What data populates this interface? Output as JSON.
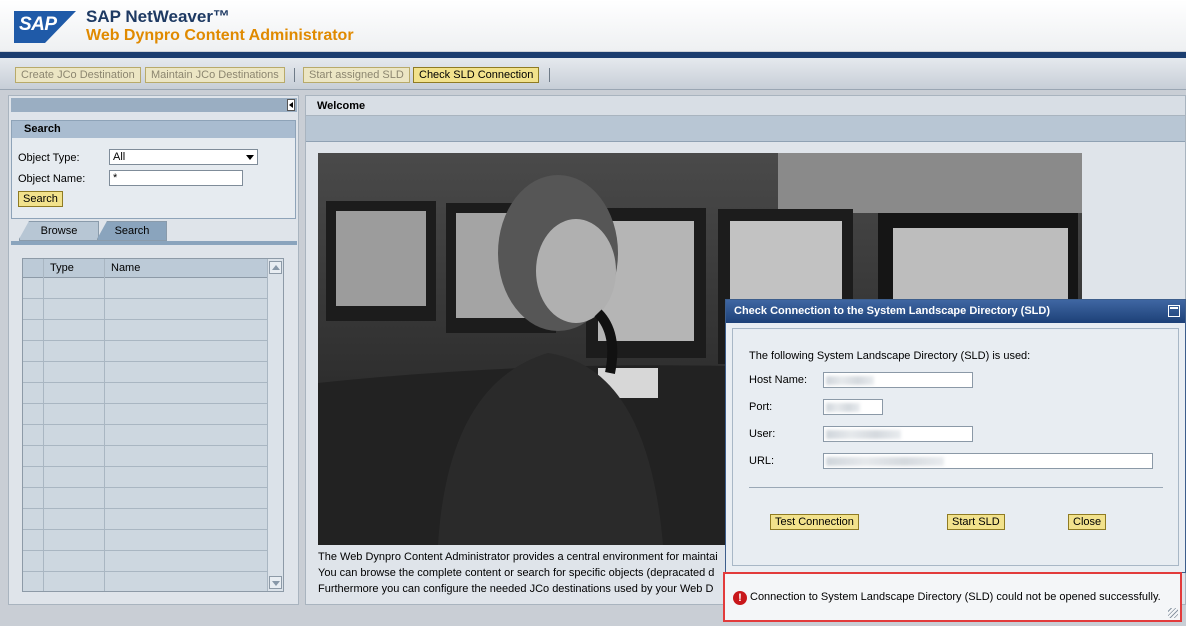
{
  "header": {
    "logo_text": "SAP",
    "product": "SAP NetWeaver™",
    "app_title": "Web Dynpro Content Administrator"
  },
  "toolbar": {
    "buttons": [
      {
        "label": "Create JCo Destination",
        "state": "disabled"
      },
      {
        "label": "Maintain JCo Destinations",
        "state": "disabled"
      },
      {
        "label": "Start assigned SLD",
        "state": "disabled"
      },
      {
        "label": "Check SLD Connection",
        "state": "active"
      }
    ]
  },
  "left": {
    "search_title": "Search",
    "object_type_label": "Object Type:",
    "object_type_value": "All",
    "object_name_label": "Object Name:",
    "object_name_value": "*",
    "search_button": "Search",
    "tabs": [
      {
        "label": "Browse",
        "selected": false
      },
      {
        "label": "Search",
        "selected": true
      }
    ],
    "table": {
      "columns": [
        "Type",
        "Name"
      ],
      "rows": []
    }
  },
  "main": {
    "tab_title": "Welcome",
    "description_lines": [
      "The Web Dynpro Content Administrator provides a central environment for maintai",
      "You can browse the complete content or search for specific objects (depracated d",
      "Furthermore you can configure the needed JCo destinations used by your Web D"
    ]
  },
  "dialog": {
    "title": "Check Connection to the System Landscape Directory (SLD)",
    "intro": "The following System Landscape Directory (SLD) is used:",
    "host_label": "Host Name:",
    "port_label": "Port:",
    "user_label": "User:",
    "url_label": "URL:",
    "test_button": "Test Connection",
    "start_button": "Start SLD",
    "close_button": "Close"
  },
  "message": {
    "type": "error",
    "text": "Connection to System Landscape Directory (SLD) could not be opened successfully."
  },
  "colors": {
    "brand_blue": "#1b3d6f",
    "brand_orange": "#e08a00",
    "button_yellow": "#f2e28c",
    "error_red": "#c8171b"
  }
}
